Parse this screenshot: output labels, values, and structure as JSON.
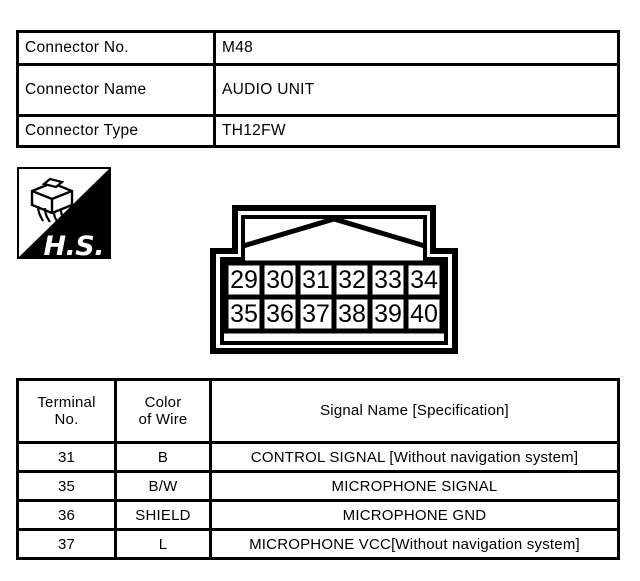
{
  "info": {
    "rows": [
      {
        "label": "Connector No.",
        "value": "M48"
      },
      {
        "label": "Connector Name",
        "value": "AUDIO UNIT"
      },
      {
        "label": "Connector Type",
        "value": "TH12FW"
      }
    ]
  },
  "hs_badge": {
    "text": "H.S.",
    "icon": "connector-harness-icon"
  },
  "connector_diagram": {
    "top_row": [
      "29",
      "30",
      "31",
      "32",
      "33",
      "34"
    ],
    "bottom_row": [
      "35",
      "36",
      "37",
      "38",
      "39",
      "40"
    ]
  },
  "terminal_table": {
    "headers": {
      "terminal_line1": "Terminal",
      "terminal_line2": "No.",
      "color_line1": "Color",
      "color_line2": "of Wire",
      "signal": "Signal Name [Specification]"
    },
    "rows": [
      {
        "terminal": "31",
        "color": "B",
        "signal": "CONTROL SIGNAL [Without navigation system]",
        "size": "small"
      },
      {
        "terminal": "35",
        "color": "B/W",
        "signal": "MICROPHONE SIGNAL",
        "size": "big"
      },
      {
        "terminal": "36",
        "color": "SHIELD",
        "signal": "MICROPHONE GND",
        "size": "big"
      },
      {
        "terminal": "37",
        "color": "L",
        "signal": "MICROPHONE VCC[Without navigation system]",
        "size": "small"
      }
    ]
  },
  "colors": {
    "ink": "#000000",
    "paper": "#ffffff"
  }
}
